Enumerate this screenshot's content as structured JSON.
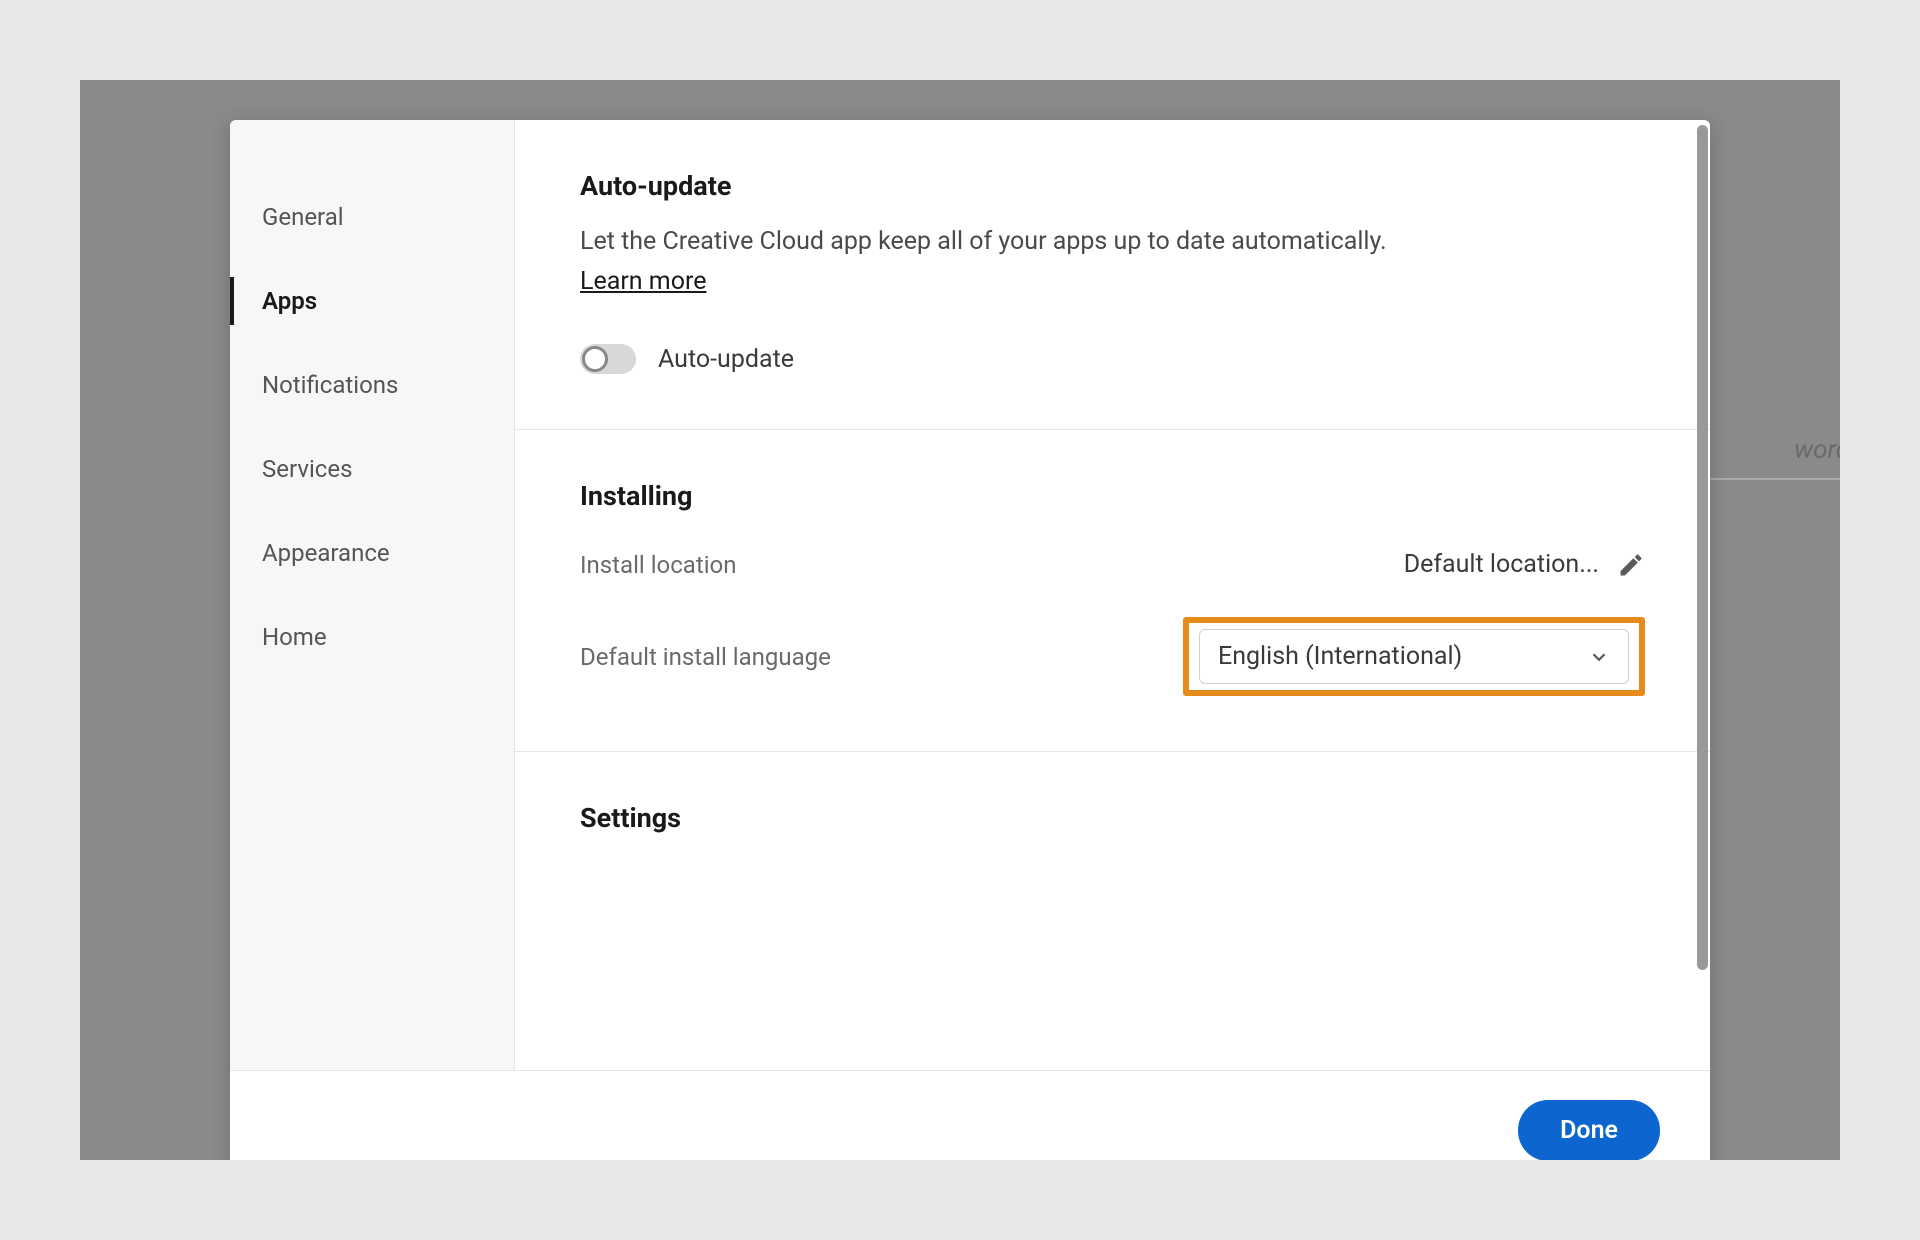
{
  "background": {
    "partial_text": "word"
  },
  "sidebar": {
    "items": [
      {
        "label": "General",
        "active": false
      },
      {
        "label": "Apps",
        "active": true
      },
      {
        "label": "Notifications",
        "active": false
      },
      {
        "label": "Services",
        "active": false
      },
      {
        "label": "Appearance",
        "active": false
      },
      {
        "label": "Home",
        "active": false
      }
    ]
  },
  "sections": {
    "auto_update": {
      "title": "Auto-update",
      "description": "Let the Creative Cloud app keep all of your apps up to date automatically.",
      "learn_more": "Learn more",
      "toggle_label": "Auto-update",
      "toggle_on": false
    },
    "installing": {
      "title": "Installing",
      "location_label": "Install location",
      "location_value": "Default location...",
      "language_label": "Default install language",
      "language_value": "English (International)"
    },
    "settings": {
      "title": "Settings"
    }
  },
  "footer": {
    "done_label": "Done"
  },
  "colors": {
    "highlight": "#e68a1a",
    "primary": "#0d66d0"
  }
}
